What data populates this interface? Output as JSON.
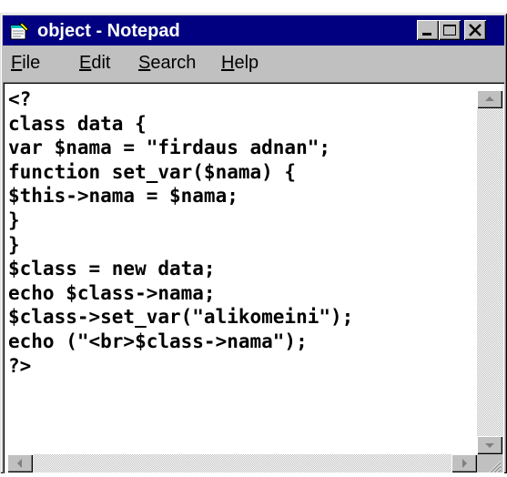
{
  "window": {
    "title": "object - Notepad",
    "icon": "notepad-icon",
    "controls": [
      "minimize-icon",
      "maximize-icon",
      "close-icon"
    ]
  },
  "menu": {
    "file": {
      "accel": "F",
      "rest": "ile"
    },
    "edit": {
      "accel": "E",
      "rest": "dit"
    },
    "search": {
      "accel": "S",
      "rest": "earch"
    },
    "help": {
      "accel": "H",
      "rest": "elp"
    }
  },
  "editor": {
    "lines": [
      "<?",
      "class data {",
      "var $nama = \"firdaus adnan\";",
      "function set_var($nama) {",
      "$this->nama = $nama;",
      "}",
      "}",
      "$class = new data;",
      "echo $class->nama;",
      "$class->set_var(\"alikomeini\");",
      "echo (\"<br>$class->nama\");",
      "?>"
    ]
  },
  "colors": {
    "titlebar": "#000080",
    "face": "#c0c0c0",
    "editor_bg": "#ffffff"
  }
}
